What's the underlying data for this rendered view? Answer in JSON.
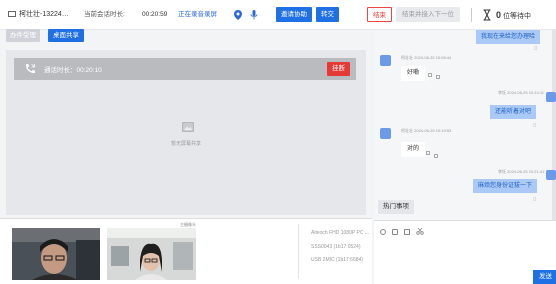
{
  "topbar": {
    "caller": "柯壮壮-13224…",
    "duration_label": "当前会话时长:",
    "duration_value": "00:20:59",
    "recording_status": "正在录音录屏",
    "assist_button": "邀请协助",
    "transfer_button": "转交",
    "end_button": "结束",
    "end_next_button": "结束并接入下一位",
    "queue_count": "0",
    "queue_label": "位等待中"
  },
  "toolbar": {
    "handle_button": "办件受理",
    "share_button": "桌面共享"
  },
  "call": {
    "duration_text": "通话时长：00:20:10",
    "hangup_button": "挂断",
    "screen_share_text": "暂无屏幕共享"
  },
  "video": {
    "tag": "主摄像头",
    "devices": [
      "Aiteoch FHD 1080P PC ...",
      "SSS0043 (1b17:0524)",
      "USB 2MIC (1b17:6684)"
    ]
  },
  "chat": {
    "messages": [
      {
        "side": "right",
        "text": "我现在来给您办理哈"
      },
      {
        "side": "left",
        "name": "柯壮壮",
        "time": "2024-06-25 10:08:44",
        "text": "好嘞"
      },
      {
        "side": "right",
        "name": "李钰",
        "time": "2024-06-25 10:14:11",
        "text": "还能听着对吧"
      },
      {
        "side": "left",
        "name": "柯壮壮",
        "time": "2024-06-25 10:19:53",
        "text": "对的"
      },
      {
        "side": "right",
        "name": "李钰",
        "time": "2024-06-25 10:21:41",
        "text": "麻烦您身份证拔一下"
      }
    ],
    "hot_topics": "热门事项",
    "send_button": "发送"
  },
  "colors": {
    "primary": "#1f6fe5",
    "danger": "#e53935",
    "bubble_right": "#aac9f7"
  },
  "icons": [
    "monitor-icon",
    "location-icon",
    "microphone-icon",
    "phone-icon",
    "screen-share-icon",
    "hourglass-icon",
    "emoji-icon",
    "image-icon",
    "folder-icon",
    "scissors-icon"
  ]
}
